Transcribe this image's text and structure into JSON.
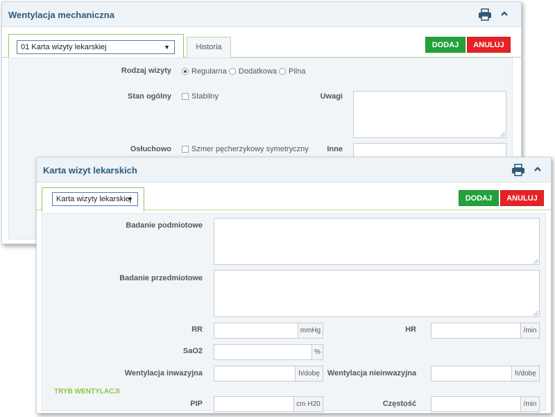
{
  "back_panel": {
    "title": "Wentylacja mechaniczna",
    "icons": [
      "printer-icon",
      "chevron-up-icon"
    ],
    "select_value": "01 Karta wizyty lekarskiej",
    "tab_history": "Historia",
    "add_label": "DODAJ",
    "cancel_label": "ANULUJ",
    "visit_type_label": "Rodzaj wizyty",
    "visit_options": [
      "Regularna",
      "Dodatkowa",
      "Pilna"
    ],
    "visit_selected": "Regularna",
    "general_label": "Stan ogólny",
    "general_option": "Stabilny",
    "notes_label": "Uwagi",
    "auscultation_label": "Osłuchowo",
    "auscultation_option": "Szmer pęcherzykowy symetryczny",
    "other_label": "Inne"
  },
  "front_panel": {
    "title": "Karta wizyt lekarskich",
    "icons": [
      "printer-icon",
      "chevron-up-icon"
    ],
    "select_value": "Karta wizyty lekarskiej",
    "add_label": "DODAJ",
    "cancel_label": "ANULUJ",
    "subjective_label": "Badanie podmiotowe",
    "objective_label": "Badanie przedmiotowe",
    "rr_label": "RR",
    "rr_unit": "mmHg",
    "hr_label": "HR",
    "hr_unit": "/min",
    "sao2_label": "SaO2",
    "sao2_unit": "%",
    "invasive_label": "Wentylacja inwazyjna",
    "invasive_unit": "h/dobę",
    "noninvasive_label": "Wentylacja nieinwazyjna",
    "noninvasive_unit": "h/dobę",
    "section_mode": "TRYB WENTYLACJI",
    "pip_label": "PIP",
    "pip_unit": "cm H20",
    "freq_label": "Częstość",
    "freq_unit": "/min"
  },
  "colors": {
    "header_bg": "#edf3f7",
    "title": "#2d5a7b",
    "green": "#22a23c",
    "red": "#e52326",
    "section": "#8dc63f"
  }
}
